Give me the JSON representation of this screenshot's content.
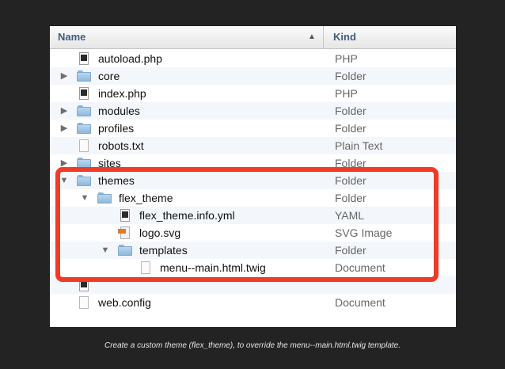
{
  "header": {
    "name_label": "Name",
    "kind_label": "Kind"
  },
  "rows": [
    {
      "name": "autoload.php",
      "kind": "PHP",
      "icon": "php-file-icon",
      "indent": 0,
      "disclosure": ""
    },
    {
      "name": "core",
      "kind": "Folder",
      "icon": "folder-icon",
      "indent": 0,
      "disclosure": "collapsed"
    },
    {
      "name": "index.php",
      "kind": "PHP",
      "icon": "php-file-icon",
      "indent": 0,
      "disclosure": ""
    },
    {
      "name": "modules",
      "kind": "Folder",
      "icon": "folder-icon",
      "indent": 0,
      "disclosure": "collapsed"
    },
    {
      "name": "profiles",
      "kind": "Folder",
      "icon": "folder-icon",
      "indent": 0,
      "disclosure": "collapsed"
    },
    {
      "name": "robots.txt",
      "kind": "Plain Text",
      "icon": "text-file-icon",
      "indent": 0,
      "disclosure": ""
    },
    {
      "name": "sites",
      "kind": "Folder",
      "icon": "folder-icon",
      "indent": 0,
      "disclosure": "collapsed"
    },
    {
      "name": "themes",
      "kind": "Folder",
      "icon": "folder-icon",
      "indent": 0,
      "disclosure": "expanded"
    },
    {
      "name": "flex_theme",
      "kind": "Folder",
      "icon": "folder-icon",
      "indent": 1,
      "disclosure": "expanded"
    },
    {
      "name": "flex_theme.info.yml",
      "kind": "YAML",
      "icon": "yaml-file-icon",
      "indent": 2,
      "disclosure": ""
    },
    {
      "name": "logo.svg",
      "kind": "SVG Image",
      "icon": "svg-image-icon",
      "indent": 2,
      "disclosure": ""
    },
    {
      "name": "templates",
      "kind": "Folder",
      "icon": "folder-icon",
      "indent": 2,
      "disclosure": "expanded"
    },
    {
      "name": "menu--main.html.twig",
      "kind": "Document",
      "icon": "document-icon",
      "indent": 3,
      "disclosure": ""
    },
    {
      "name": "",
      "kind": "",
      "icon": "php-file-icon",
      "indent": 0,
      "disclosure": ""
    },
    {
      "name": "web.config",
      "kind": "Document",
      "icon": "document-icon",
      "indent": 0,
      "disclosure": ""
    }
  ],
  "caption": "Create a custom theme (flex_theme), to override the menu--main.html.twig template.",
  "colors": {
    "highlight": "#f03b26",
    "background": "#232323"
  }
}
